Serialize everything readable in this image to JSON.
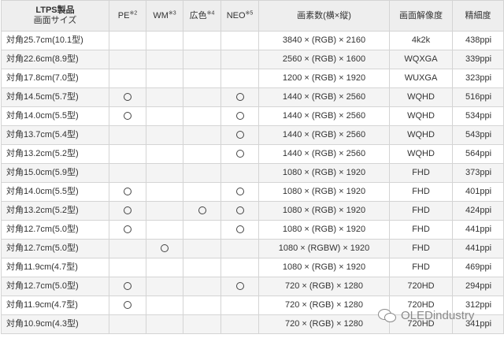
{
  "table": {
    "headers": [
      {
        "line1": "LTPS製品",
        "line2": "画面サイズ"
      },
      {
        "text": "PE",
        "note": "※2"
      },
      {
        "text": "WM",
        "note": "※3"
      },
      {
        "text": "広色",
        "note": "※4"
      },
      {
        "text": "NEO",
        "note": "※5"
      },
      {
        "text": "画素数(横×縦)"
      },
      {
        "text": "画面解像度"
      },
      {
        "text": "精細度"
      }
    ],
    "mark_symbol": "○",
    "rows": [
      {
        "name": "対角25.7cm(10.1型)",
        "pe": false,
        "wm": false,
        "wide": false,
        "neo": false,
        "pixels": "3840 × (RGB) × 2160",
        "format": "4k2k",
        "ppi": "438ppi"
      },
      {
        "name": "対角22.6cm(8.9型)",
        "pe": false,
        "wm": false,
        "wide": false,
        "neo": false,
        "pixels": "2560 × (RGB) × 1600",
        "format": "WQXGA",
        "ppi": "339ppi"
      },
      {
        "name": "対角17.8cm(7.0型)",
        "pe": false,
        "wm": false,
        "wide": false,
        "neo": false,
        "pixels": "1200 × (RGB) × 1920",
        "format": "WUXGA",
        "ppi": "323ppi"
      },
      {
        "name": "対角14.5cm(5.7型)",
        "pe": true,
        "wm": false,
        "wide": false,
        "neo": true,
        "pixels": "1440 × (RGB) × 2560",
        "format": "WQHD",
        "ppi": "516ppi"
      },
      {
        "name": "対角14.0cm(5.5型)",
        "pe": true,
        "wm": false,
        "wide": false,
        "neo": true,
        "pixels": "1440 × (RGB) × 2560",
        "format": "WQHD",
        "ppi": "534ppi"
      },
      {
        "name": "対角13.7cm(5.4型)",
        "pe": false,
        "wm": false,
        "wide": false,
        "neo": true,
        "pixels": "1440 × (RGB) × 2560",
        "format": "WQHD",
        "ppi": "543ppi"
      },
      {
        "name": "対角13.2cm(5.2型)",
        "pe": false,
        "wm": false,
        "wide": false,
        "neo": true,
        "pixels": "1440 × (RGB) × 2560",
        "format": "WQHD",
        "ppi": "564ppi"
      },
      {
        "name": "対角15.0cm(5.9型)",
        "pe": false,
        "wm": false,
        "wide": false,
        "neo": false,
        "pixels": "1080 × (RGB) × 1920",
        "format": "FHD",
        "ppi": "373ppi"
      },
      {
        "name": "対角14.0cm(5.5型)",
        "pe": true,
        "wm": false,
        "wide": false,
        "neo": true,
        "pixels": "1080 × (RGB) × 1920",
        "format": "FHD",
        "ppi": "401ppi"
      },
      {
        "name": "対角13.2cm(5.2型)",
        "pe": true,
        "wm": false,
        "wide": true,
        "neo": true,
        "pixels": "1080 × (RGB) × 1920",
        "format": "FHD",
        "ppi": "424ppi"
      },
      {
        "name": "対角12.7cm(5.0型)",
        "pe": true,
        "wm": false,
        "wide": false,
        "neo": true,
        "pixels": "1080 × (RGB) × 1920",
        "format": "FHD",
        "ppi": "441ppi"
      },
      {
        "name": "対角12.7cm(5.0型)",
        "pe": false,
        "wm": true,
        "wide": false,
        "neo": false,
        "pixels": "1080 × (RGBW) × 1920",
        "format": "FHD",
        "ppi": "441ppi"
      },
      {
        "name": "対角11.9cm(4.7型)",
        "pe": false,
        "wm": false,
        "wide": false,
        "neo": false,
        "pixels": "1080 × (RGB) × 1920",
        "format": "FHD",
        "ppi": "469ppi"
      },
      {
        "name": "対角12.7cm(5.0型)",
        "pe": true,
        "wm": false,
        "wide": false,
        "neo": true,
        "pixels": "720 × (RGB) × 1280",
        "format": "720HD",
        "ppi": "294ppi"
      },
      {
        "name": "対角11.9cm(4.7型)",
        "pe": true,
        "wm": false,
        "wide": false,
        "neo": false,
        "pixels": "720 × (RGB) × 1280",
        "format": "720HD",
        "ppi": "312ppi"
      },
      {
        "name": "対角10.9cm(4.3型)",
        "pe": false,
        "wm": false,
        "wide": false,
        "neo": false,
        "pixels": "720 × (RGB) × 1280",
        "format": "720HD",
        "ppi": "341ppi"
      }
    ]
  },
  "watermark": {
    "text": "OLEDindustry",
    "icon": "wechat-icon"
  }
}
